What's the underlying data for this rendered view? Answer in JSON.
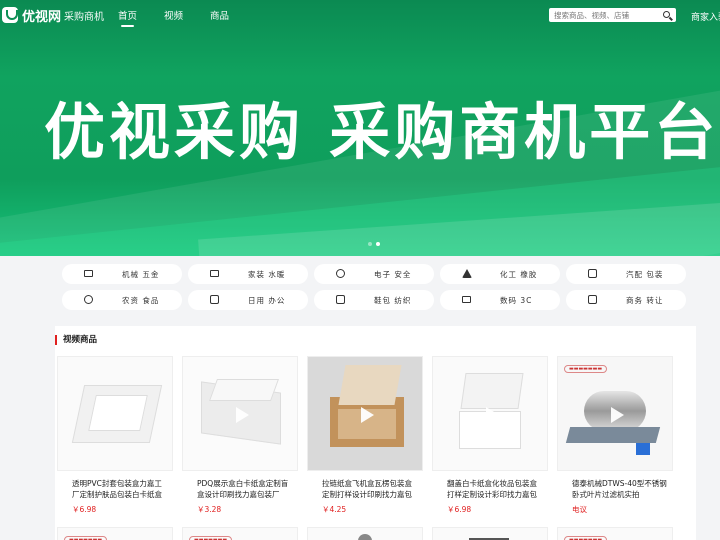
{
  "header": {
    "logo_text": "优视网",
    "logo_sub": "采购商机",
    "nav": [
      "首页",
      "视频",
      "商品"
    ],
    "search_placeholder": "搜索商品、视频、店铺",
    "merchant": "商家入驻"
  },
  "banner": {
    "title": "优视采购  采购商机平台",
    "slides": 2,
    "active_slide": 2
  },
  "categories": [
    {
      "label": "机械  五金",
      "icon": "paint-roller-icon"
    },
    {
      "label": "家装  水暖",
      "icon": "paint-brush-icon"
    },
    {
      "label": "电子  安全",
      "icon": "chip-icon"
    },
    {
      "label": "化工  橡胶",
      "icon": "flask-icon"
    },
    {
      "label": "汽配  包装",
      "icon": "box-icon"
    },
    {
      "label": "农资  食品",
      "icon": "apple-icon"
    },
    {
      "label": "日用  办公",
      "icon": "cup-icon"
    },
    {
      "label": "鞋包  纺织",
      "icon": "shirt-icon"
    },
    {
      "label": "数码  3C",
      "icon": "laptop-icon"
    },
    {
      "label": "商务  转让",
      "icon": "briefcase-icon"
    }
  ],
  "section": {
    "title": "视频商品"
  },
  "products": [
    {
      "name": "透明PVC封套包装盒力嘉工厂定制护肤品包装白卡纸盒",
      "price": "￥6.98"
    },
    {
      "name": "PDQ展示盒白卡纸盒定制盲盒设计印刷找力嘉包装厂",
      "price": "￥3.28"
    },
    {
      "name": "拉链纸盒飞机盒瓦楞包装盒定制打样设计印刷找力嘉包装厂家",
      "price": "￥4.25"
    },
    {
      "name": "翻盖白卡纸盒化妆品包装盒打样定制设计彩印找力嘉包装工厂",
      "price": "￥6.98"
    },
    {
      "name": "德泰机械DTWS-40型不锈钢卧式叶片过滤机实拍",
      "price": "电议"
    }
  ],
  "colors": {
    "brand_green": "#0f9e5c",
    "price_red": "#e02020"
  }
}
